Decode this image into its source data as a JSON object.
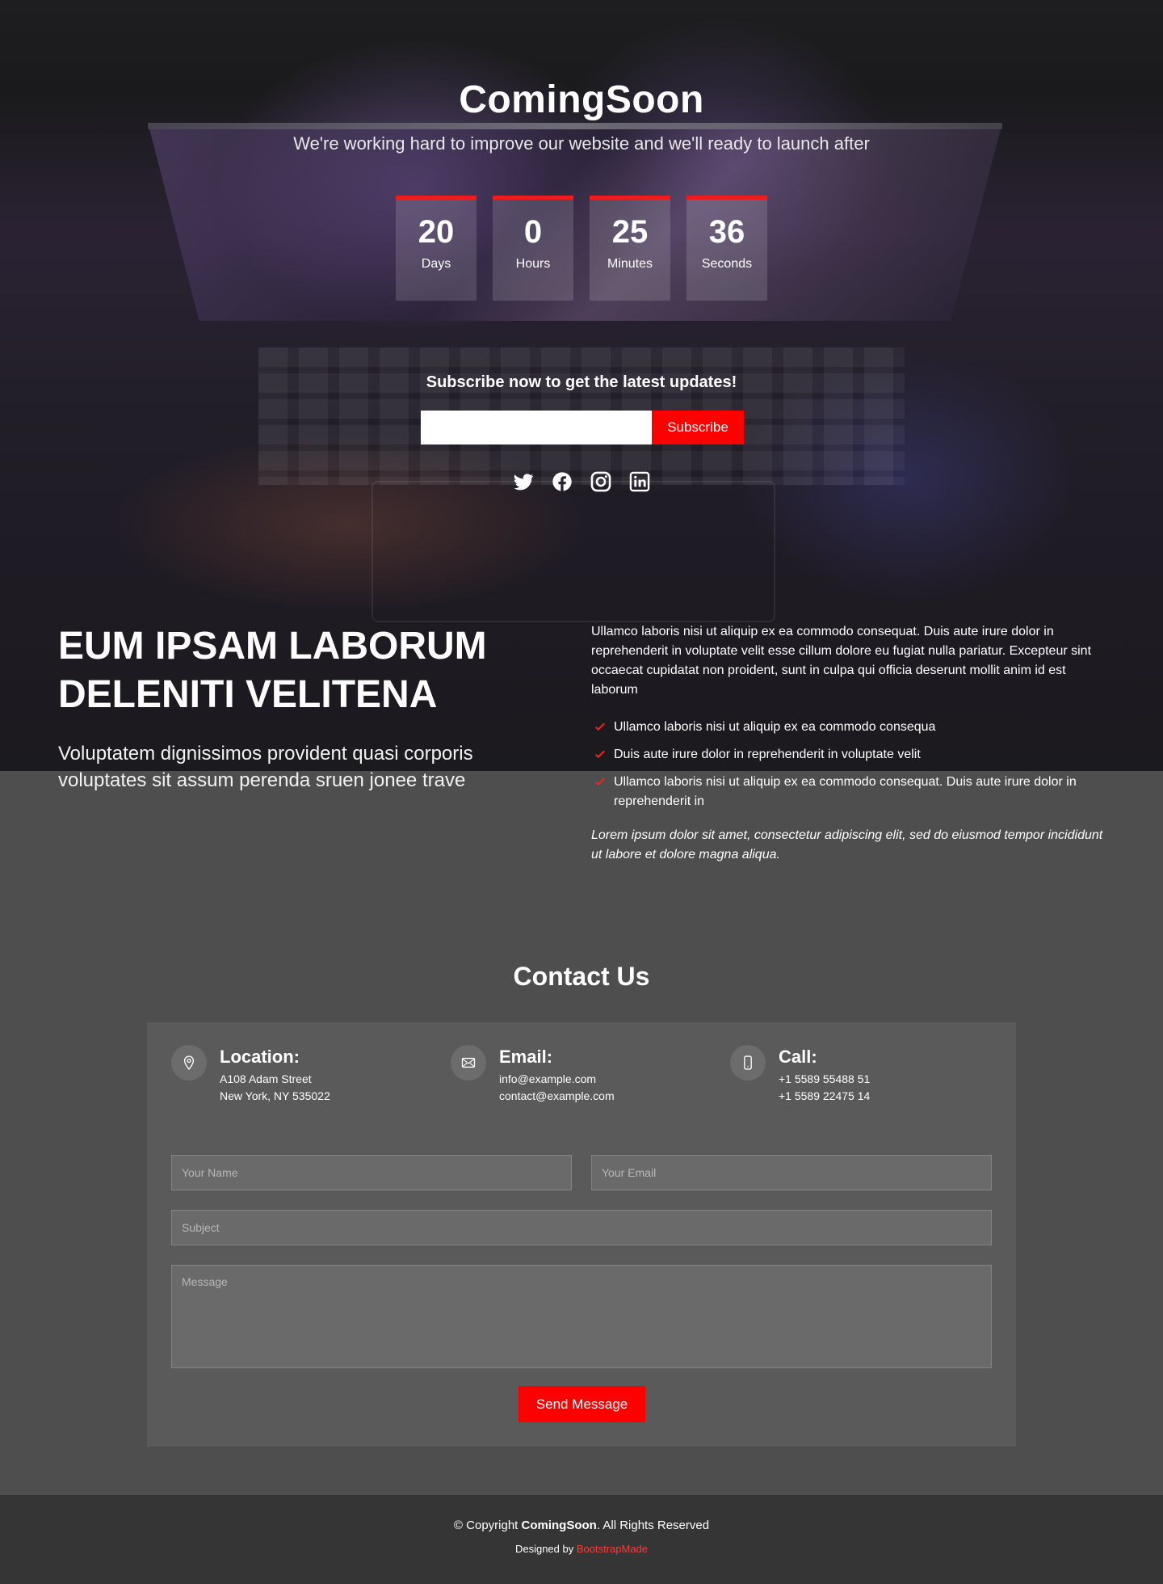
{
  "hero": {
    "title": "ComingSoon",
    "subtitle": "We're working hard to improve our website and we'll ready to launch after",
    "countdown": [
      {
        "value": "20",
        "label": "Days"
      },
      {
        "value": "0",
        "label": "Hours"
      },
      {
        "value": "25",
        "label": "Minutes"
      },
      {
        "value": "36",
        "label": "Seconds"
      }
    ],
    "subscribe_title": "Subscribe now to get the latest updates!",
    "subscribe_input_value": "",
    "subscribe_button": "Subscribe",
    "socials": [
      "twitter-icon",
      "facebook-icon",
      "instagram-icon",
      "linkedin-icon"
    ]
  },
  "about": {
    "heading": "EUM IPSAM LABORUM DELENITI VELITENA",
    "lead": "Voluptatem dignissimos provident quasi corporis voluptates sit assum perenda sruen jonee trave",
    "paragraph": "Ullamco laboris nisi ut aliquip ex ea commodo consequat. Duis aute irure dolor in reprehenderit in voluptate velit esse cillum dolore eu fugiat nulla pariatur. Excepteur sint occaecat cupidatat non proident, sunt in culpa qui officia deserunt mollit anim id est laborum",
    "list": [
      "Ullamco laboris nisi ut aliquip ex ea commodo consequa",
      "Duis aute irure dolor in reprehenderit in voluptate velit",
      "Ullamco laboris nisi ut aliquip ex ea commodo consequat. Duis aute irure dolor in reprehenderit in"
    ],
    "italic": "Lorem ipsum dolor sit amet, consectetur adipiscing elit, sed do eiusmod tempor incididunt ut labore et dolore magna aliqua."
  },
  "contact": {
    "title": "Contact Us",
    "info": [
      {
        "icon": "map-pin-icon",
        "title": "Location:",
        "line1": "A108 Adam Street",
        "line2": "New York, NY 535022"
      },
      {
        "icon": "envelope-icon",
        "title": "Email:",
        "line1": "info@example.com",
        "line2": "contact@example.com"
      },
      {
        "icon": "phone-icon",
        "title": "Call:",
        "line1": "+1 5589 55488 51",
        "line2": "+1 5589 22475 14"
      }
    ],
    "form": {
      "name_placeholder": "Your Name",
      "email_placeholder": "Your Email",
      "subject_placeholder": "Subject",
      "message_placeholder": "Message",
      "send_button": "Send Message"
    }
  },
  "footer": {
    "copyright_prefix": "© Copyright ",
    "brand": "ComingSoon",
    "copyright_suffix": ". All Rights Reserved",
    "credit_prefix": "Designed by ",
    "credit_link": "BootstrapMade"
  },
  "colors": {
    "accent": "#ff0000",
    "countdown_border": "#ee1c1c",
    "page_bg": "#4e4e4e",
    "panel_bg": "#5a5a5a",
    "footer_bg": "#353535",
    "link": "#ff3b3b"
  }
}
